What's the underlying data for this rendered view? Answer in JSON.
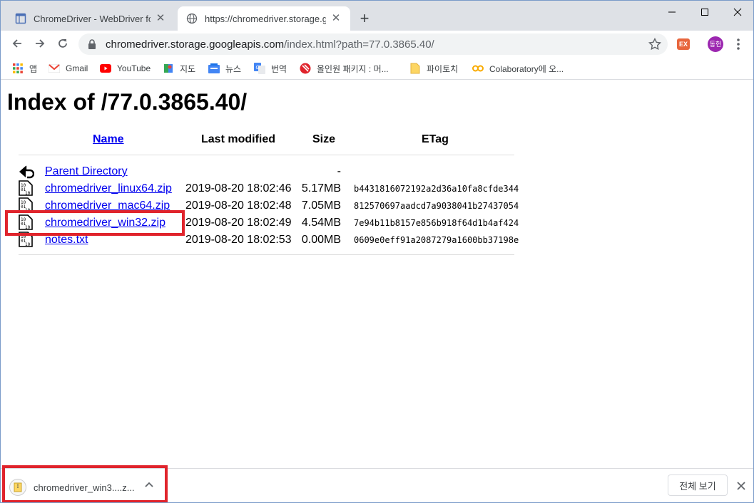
{
  "tabs": [
    {
      "title": "ChromeDriver - WebDriver for Chrome",
      "active": false
    },
    {
      "title": "https://chromedriver.storage.googleapis.com/index.html",
      "active": true
    }
  ],
  "address": {
    "host": "chromedriver.storage.googleapis.com",
    "rest": "/index.html?path=77.0.3865.40/"
  },
  "extension_label": "EX",
  "profile_label": "동헌",
  "bookmarks": [
    {
      "label": "앱",
      "icon": "apps-icon"
    },
    {
      "label": "Gmail",
      "icon": "gmail-icon"
    },
    {
      "label": "YouTube",
      "icon": "youtube-icon"
    },
    {
      "label": "지도",
      "icon": "maps-icon"
    },
    {
      "label": "뉴스",
      "icon": "news-icon"
    },
    {
      "label": "번역",
      "icon": "translate-icon"
    },
    {
      "label": "올인원 패키지 : 머...",
      "icon": "site-icon"
    },
    {
      "label": "파이토치",
      "icon": "folder-icon"
    },
    {
      "label": "Colaboratory에 오...",
      "icon": "colab-icon"
    }
  ],
  "page": {
    "title": "Index of /77.0.3865.40/",
    "headers": {
      "name": "Name",
      "modified": "Last modified",
      "size": "Size",
      "etag": "ETag"
    },
    "rows": [
      {
        "name": "Parent Directory",
        "modified": "",
        "size": "-",
        "etag": "",
        "icon": "back-icon"
      },
      {
        "name": "chromedriver_linux64.zip",
        "modified": "2019-08-20 18:02:46",
        "size": "5.17MB",
        "etag": "b4431816072192a2d36a10fa8cfde344",
        "icon": "binary-file-icon"
      },
      {
        "name": "chromedriver_mac64.zip",
        "modified": "2019-08-20 18:02:48",
        "size": "7.05MB",
        "etag": "812570697aadcd7a9038041b27437054",
        "icon": "binary-file-icon"
      },
      {
        "name": "chromedriver_win32.zip",
        "modified": "2019-08-20 18:02:49",
        "size": "4.54MB",
        "etag": "7e94b11b8157e856b918f64d1b4af424",
        "icon": "binary-file-icon"
      },
      {
        "name": "notes.txt",
        "modified": "2019-08-20 18:02:53",
        "size": "0.00MB",
        "etag": "0609e0eff91a2087279a1600bb37198e",
        "icon": "binary-file-icon"
      }
    ]
  },
  "download": {
    "filename": "chromedriver_win3....z...",
    "show_all_label": "전체 보기"
  },
  "colors": {
    "highlight": "#e0242c",
    "link": "#0000ee",
    "tabstrip": "#dee1e6"
  }
}
